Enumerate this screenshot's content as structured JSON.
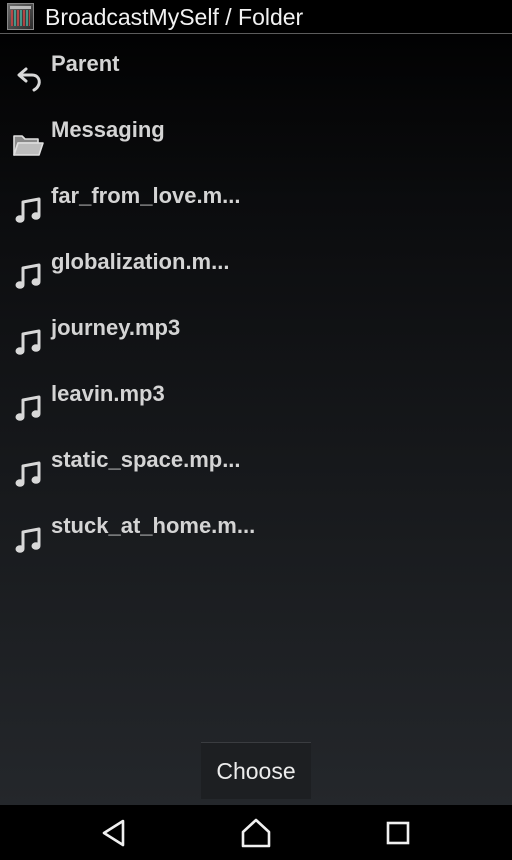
{
  "titlebar": {
    "title": "BroadcastMySelf / Folder",
    "app_icon": "broadcastmyself-app-icon"
  },
  "list": {
    "items": [
      {
        "label": "Parent",
        "icon": "undo-arrow-icon",
        "kind": "parent"
      },
      {
        "label": "Messaging",
        "icon": "folder-icon",
        "kind": "folder"
      },
      {
        "label": "far_from_love.m...",
        "icon": "music-note-icon",
        "kind": "file"
      },
      {
        "label": "globalization.m...",
        "icon": "music-note-icon",
        "kind": "file"
      },
      {
        "label": "journey.mp3",
        "icon": "music-note-icon",
        "kind": "file"
      },
      {
        "label": "leavin.mp3",
        "icon": "music-note-icon",
        "kind": "file"
      },
      {
        "label": "static_space.mp...",
        "icon": "music-note-icon",
        "kind": "file"
      },
      {
        "label": "stuck_at_home.m...",
        "icon": "music-note-icon",
        "kind": "file"
      }
    ]
  },
  "actions": {
    "choose_label": "Choose"
  },
  "navbar": {
    "back_icon": "back-triangle-icon",
    "home_icon": "home-icon",
    "recent_icon": "recent-apps-icon"
  },
  "colors": {
    "background_top": "#000000",
    "background_bottom": "#24272b",
    "text": "#d4d4d4",
    "title_divider": "#5c5c5c"
  }
}
